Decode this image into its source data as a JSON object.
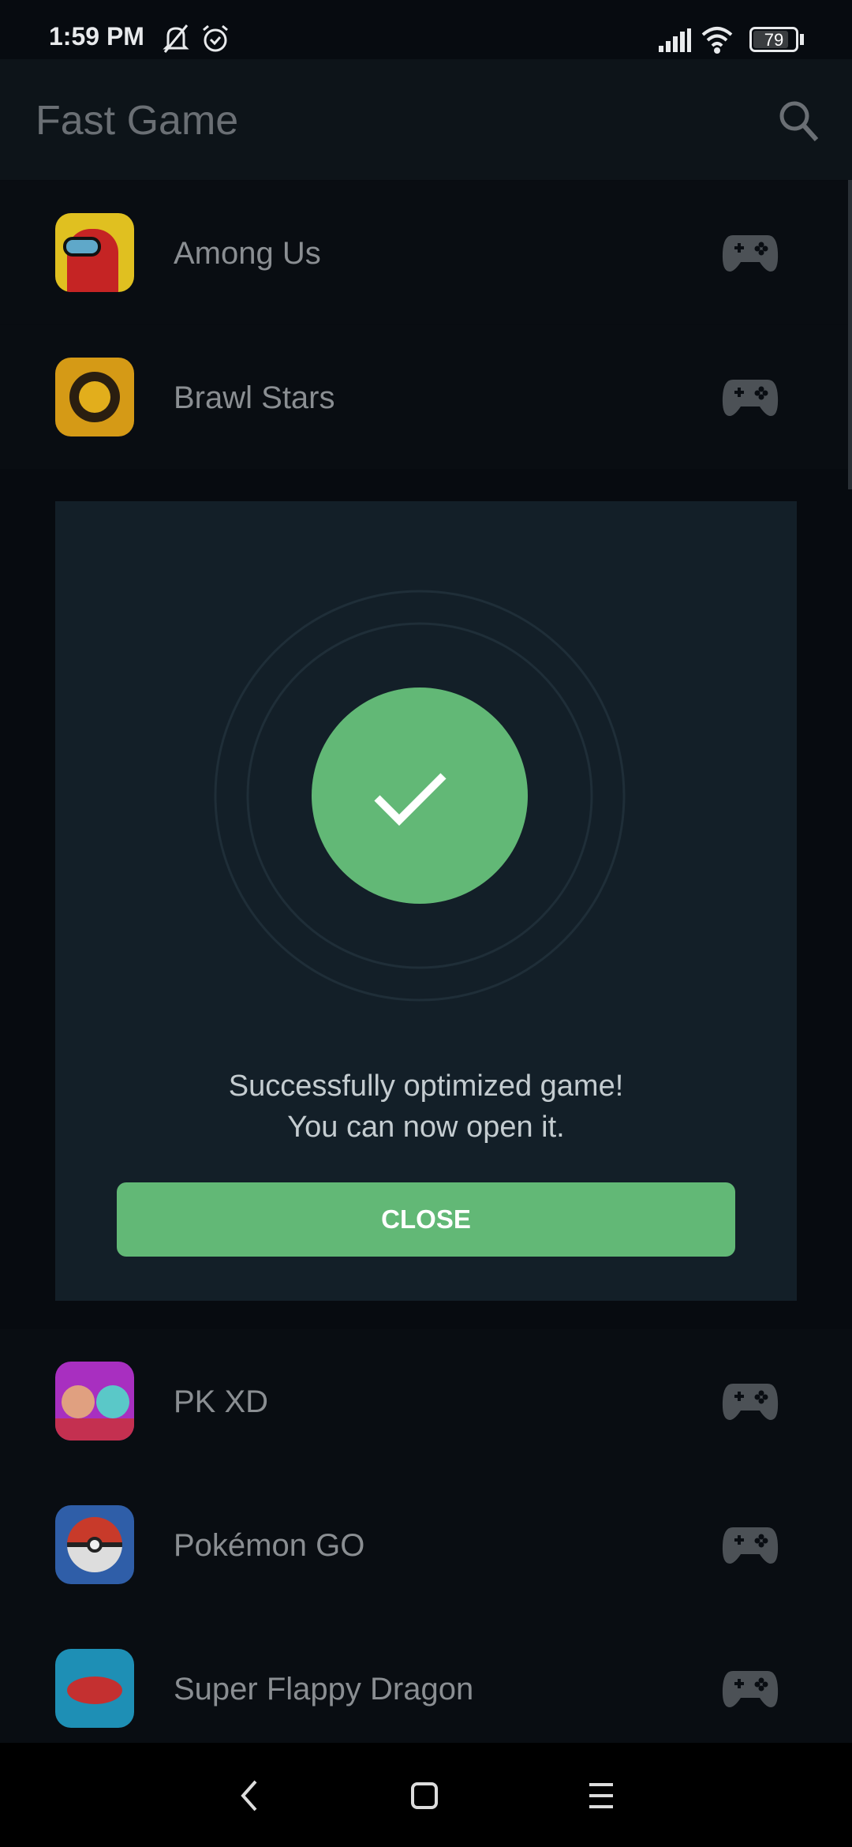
{
  "status_bar": {
    "time": "1:59 PM",
    "battery": "79"
  },
  "app_bar": {
    "title": "Fast Game"
  },
  "games": [
    {
      "name": "Among Us",
      "color": "#d22a2a"
    },
    {
      "name": "Brawl Stars",
      "color": "#e0a81a"
    },
    {
      "name": "PK XD",
      "color": "#b535c9"
    },
    {
      "name": "Pokémon GO",
      "color": "#2f6ec4"
    },
    {
      "name": "Super Flappy Dragon",
      "color": "#1e8fb5"
    }
  ],
  "dialog": {
    "line1": "Successfully optimized game!",
    "line2": "You can now open it.",
    "close_label": "CLOSE",
    "accent": "#62b876"
  }
}
